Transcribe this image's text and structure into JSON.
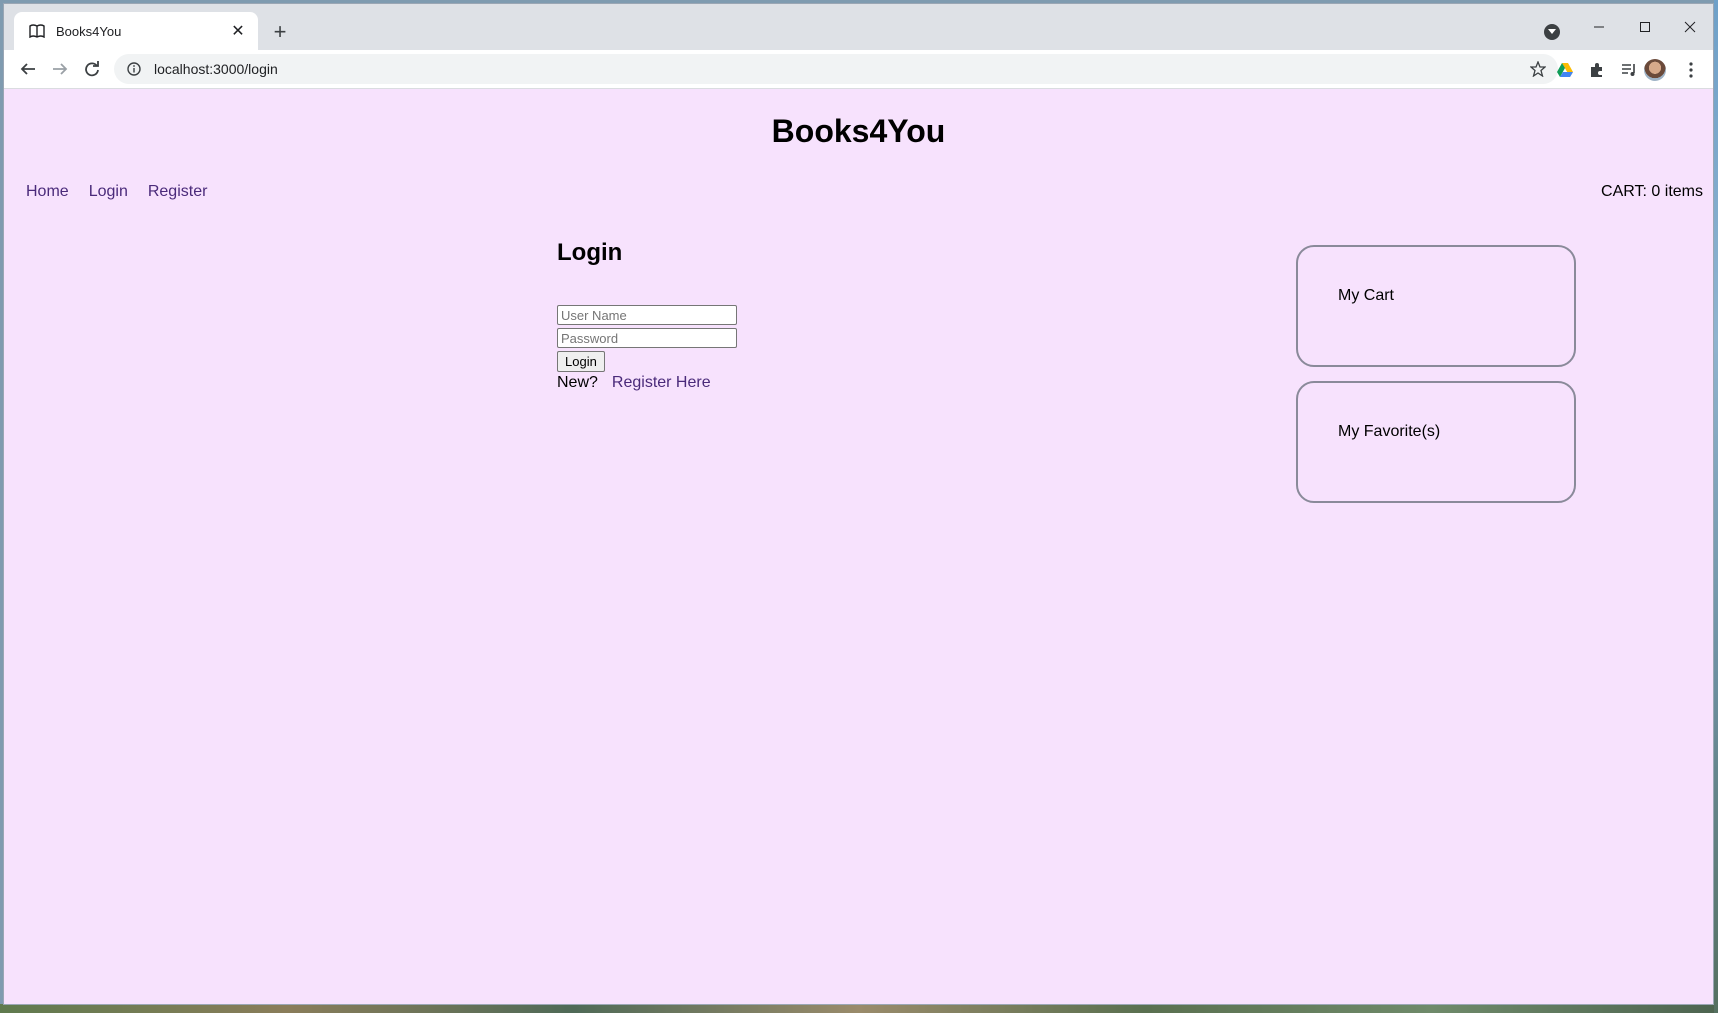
{
  "browser": {
    "tab_title": "Books4You",
    "url": "localhost:3000/login"
  },
  "site": {
    "title": "Books4You",
    "nav": [
      {
        "label": "Home"
      },
      {
        "label": "Login"
      },
      {
        "label": "Register"
      }
    ],
    "cart_count": "CART: 0 items"
  },
  "login": {
    "heading": "Login",
    "username_placeholder": "User Name",
    "password_placeholder": "Password",
    "submit_label": "Login",
    "new_label": "New?",
    "register_link": "Register Here"
  },
  "sidebar": {
    "cart_label": "My Cart",
    "favorites_label": "My Favorite(s)"
  },
  "icons": {
    "tab": "book-icon",
    "close": "close-icon",
    "new_tab": "plus-icon",
    "back": "back-arrow-icon",
    "forward": "forward-arrow-icon",
    "reload": "reload-icon",
    "info": "info-icon",
    "star": "star-icon",
    "drive": "drive-icon",
    "extensions": "puzzle-icon",
    "media": "media-queue-icon",
    "menu": "kebab-menu-icon"
  },
  "colors": {
    "page_background": "#f7e2fd",
    "link": "#4a2a7a"
  }
}
